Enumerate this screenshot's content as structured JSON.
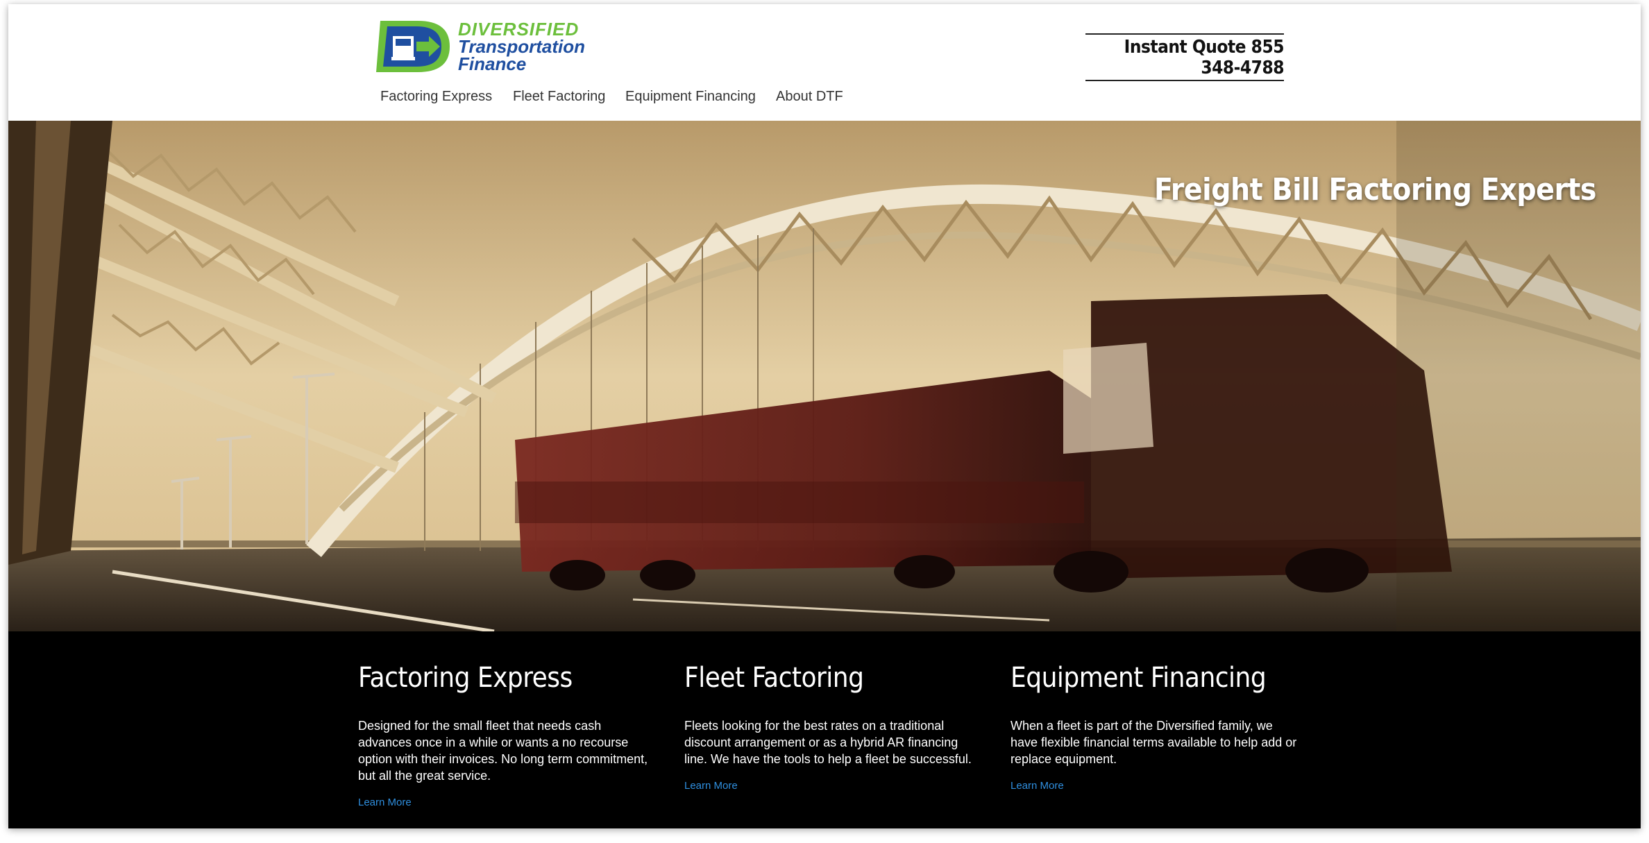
{
  "brand": {
    "name_line1": "DIVERSIFIED",
    "name_line2": "Transportation",
    "name_line3": "Finance",
    "primary_color": "#1f4fa0",
    "accent_color": "#6cbf3c"
  },
  "header": {
    "quote_text": "Instant Quote 855 348-4788"
  },
  "nav": {
    "items": [
      {
        "label": "Factoring Express"
      },
      {
        "label": "Fleet Factoring"
      },
      {
        "label": "Equipment Financing"
      },
      {
        "label": "About DTF"
      }
    ]
  },
  "hero": {
    "title": "Freight Bill Factoring Experts"
  },
  "features": [
    {
      "title": "Factoring Express",
      "description": "Designed for the small fleet that needs cash advances once in a while or wants a no recourse option with their invoices. No long term commitment, but all the great service.",
      "link": "Learn More"
    },
    {
      "title": "Fleet Factoring",
      "description": "Fleets looking for the best rates on a traditional discount arrangement or as a hybrid AR financing line. We have the tools to help a fleet be successful.",
      "link": "Learn More"
    },
    {
      "title": "Equipment Financing",
      "description": "When a fleet is part of the Diversified family, we have flexible financial terms available to help add or replace equipment.",
      "link": "Learn More"
    }
  ],
  "colors": {
    "link": "#2f8fdf",
    "footer_bg": "#000000"
  }
}
